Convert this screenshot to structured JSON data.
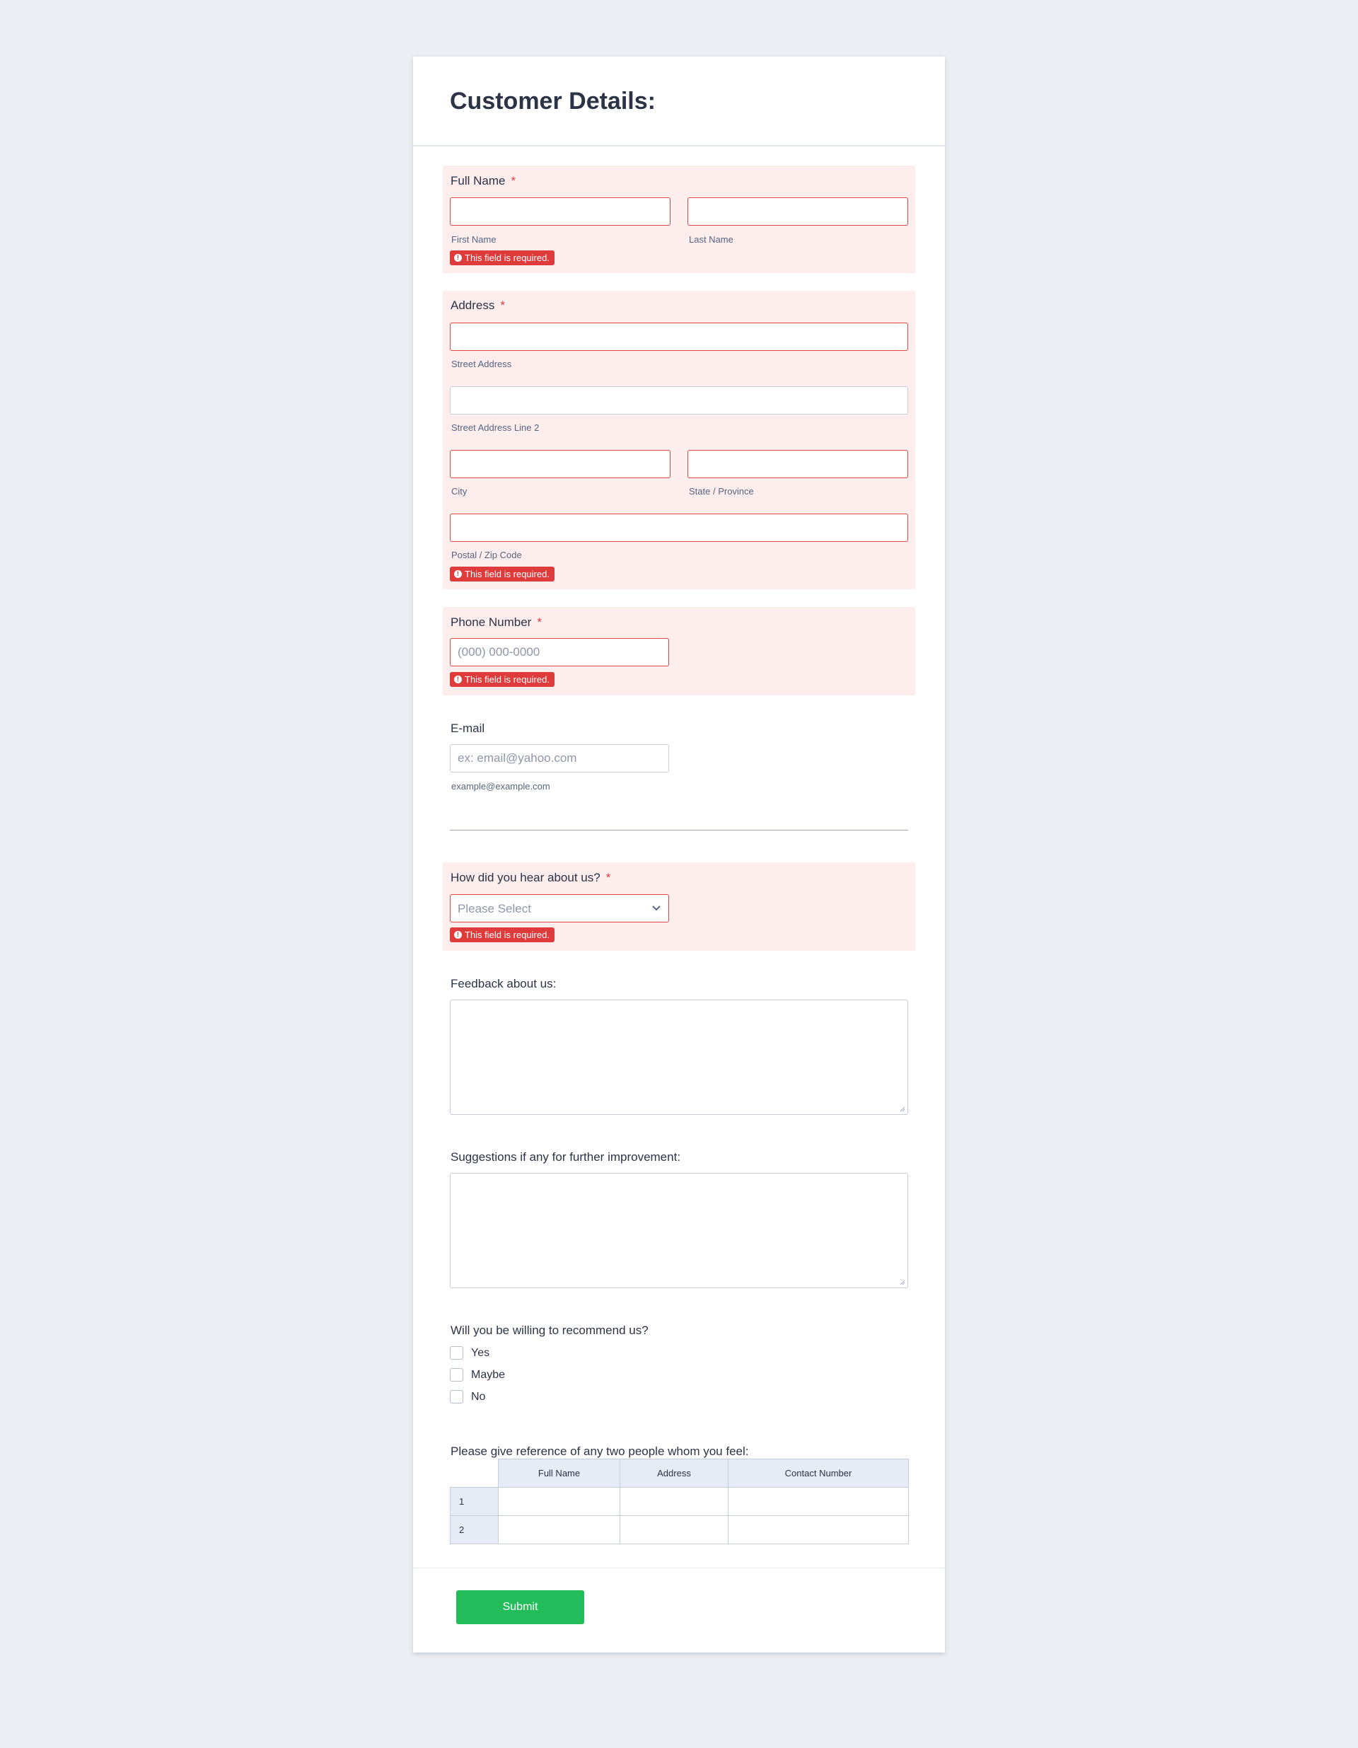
{
  "form": {
    "title": "Customer Details:",
    "required_marker": "*",
    "error_text": "This field is required.",
    "error_icon": "!",
    "full_name": {
      "label": "Full Name",
      "first_sub": "First Name",
      "last_sub": "Last Name"
    },
    "address": {
      "label": "Address",
      "street_sub": "Street Address",
      "street2_sub": "Street Address Line 2",
      "city_sub": "City",
      "state_sub": "State / Province",
      "zip_sub": "Postal / Zip Code"
    },
    "phone": {
      "label": "Phone Number",
      "placeholder": "(000) 000-0000"
    },
    "email": {
      "label": "E-mail",
      "placeholder": "ex: email@yahoo.com",
      "sub": "example@example.com"
    },
    "hear": {
      "label": "How did you hear about us?",
      "selected": "Please Select"
    },
    "feedback": {
      "label": "Feedback about us:"
    },
    "suggestions": {
      "label": "Suggestions if any for further improvement:"
    },
    "recommend": {
      "label": "Will you be willing to recommend us?",
      "options": [
        "Yes",
        "Maybe",
        "No"
      ]
    },
    "reference": {
      "label": "Please give reference of any two people whom you feel:",
      "columns": [
        "Full Name",
        "Address",
        "Contact Number"
      ],
      "rows": [
        "1",
        "2"
      ]
    },
    "submit_label": "Submit"
  },
  "colors": {
    "page_bg": "#eceef3",
    "error_bg": "#fdeded",
    "error_red": "#e03b3b",
    "submit_green": "#22bc5a",
    "table_header_bg": "#e6ebf5"
  }
}
